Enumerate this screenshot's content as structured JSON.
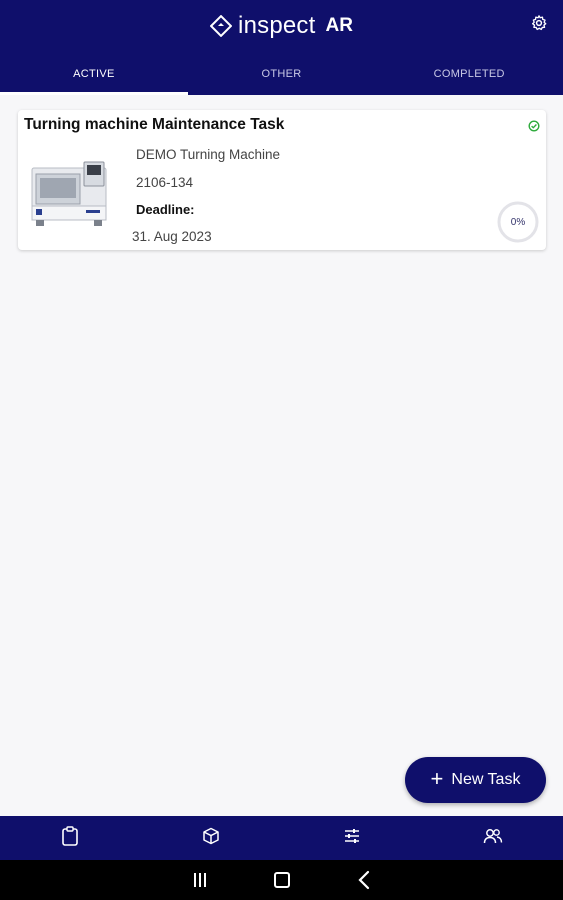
{
  "app": {
    "title_light": "inspect",
    "title_bold": "AR",
    "logo_icon": "diamond-logo-icon"
  },
  "header": {
    "settings_icon": "gear-icon"
  },
  "tabs": [
    {
      "label": "ACTIVE",
      "active": true
    },
    {
      "label": "OTHER",
      "active": false
    },
    {
      "label": "COMPLETED",
      "active": false
    }
  ],
  "task_card": {
    "title": "Turning machine Maintenance Task",
    "machine": "DEMO Turning Machine",
    "id": "2106-134",
    "deadline_label": "Deadline:",
    "deadline": "31. Aug 2023",
    "progress_label": "0%",
    "progress": 0,
    "status_icon": "check-circle-icon",
    "image": "turning-machine-thumbnail"
  },
  "fab": {
    "plus": "+",
    "label": "New Task"
  },
  "bottom_nav": [
    {
      "icon": "clipboard-icon"
    },
    {
      "icon": "cube-icon"
    },
    {
      "icon": "sliders-icon"
    },
    {
      "icon": "users-icon"
    }
  ],
  "system_nav": [
    "recent-apps-icon",
    "home-icon",
    "back-icon"
  ],
  "colors": {
    "primary": "#0f0f6b",
    "success": "#2eaa3c",
    "background": "#f7f7f9"
  }
}
